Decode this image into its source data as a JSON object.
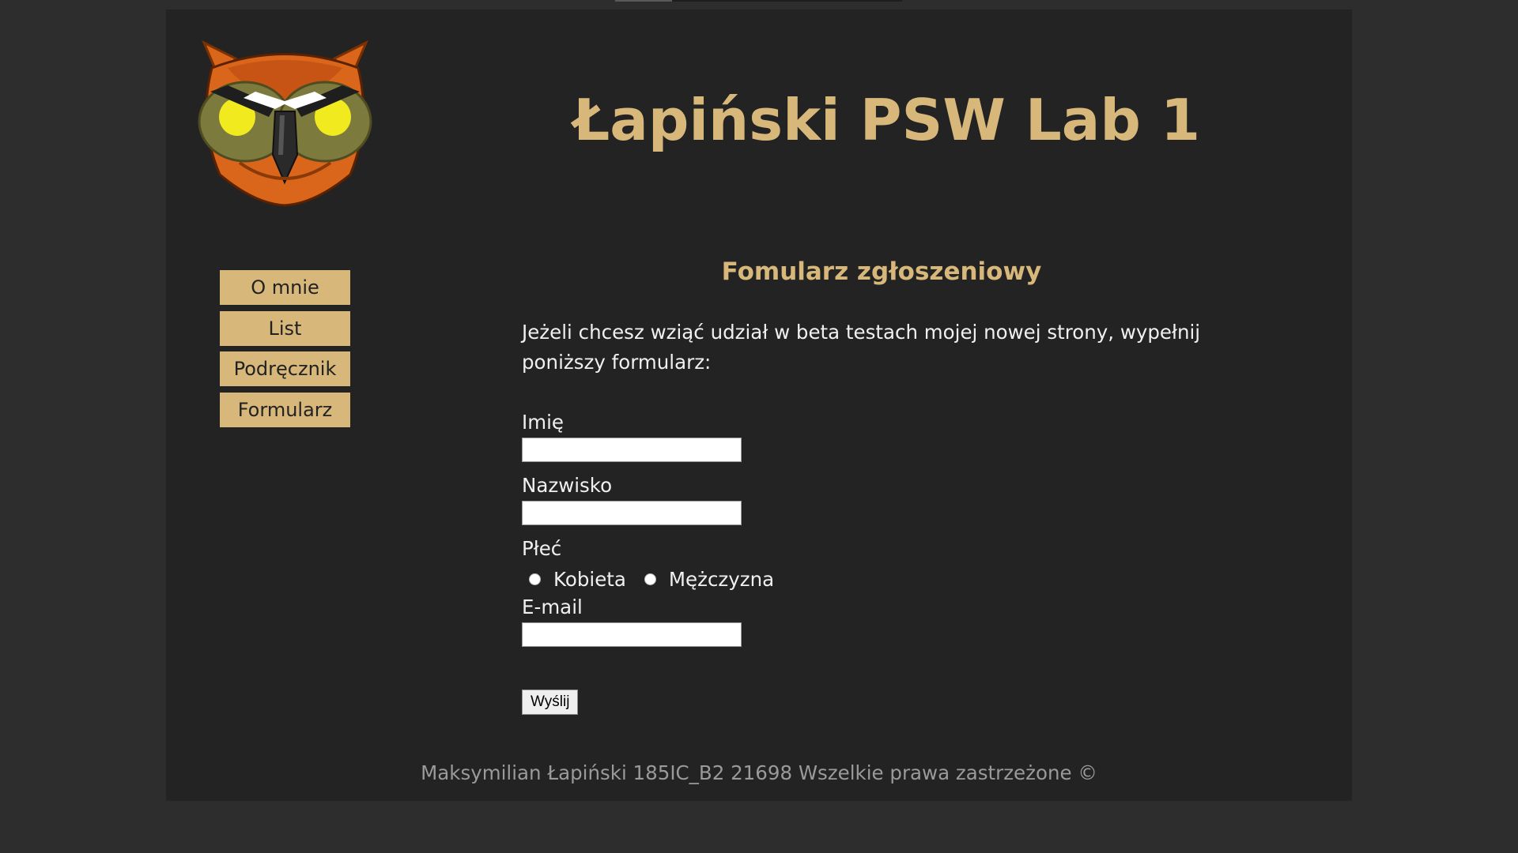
{
  "header": {
    "title": "Łapiński PSW Lab 1"
  },
  "logo": {
    "icon": "owl-logo-icon"
  },
  "nav": {
    "items": [
      {
        "label": "O mnie"
      },
      {
        "label": "List"
      },
      {
        "label": "Podręcznik"
      },
      {
        "label": "Formularz"
      }
    ]
  },
  "form": {
    "title": "Fomularz zgłoszeniowy",
    "intro": "Jeżeli chcesz wziąć udział w beta testach mojej nowej strony, wypełnij poniższy formularz:",
    "first_name": {
      "label": "Imię",
      "value": ""
    },
    "last_name": {
      "label": "Nazwisko",
      "value": ""
    },
    "gender": {
      "label": "Płeć",
      "options": [
        "Kobieta",
        "Mężczyzna"
      ]
    },
    "email": {
      "label": "E-mail",
      "value": ""
    },
    "submit_label": "Wyślij"
  },
  "footer": {
    "text": "Maksymilian Łapiński 185IC_B2 21698 Wszelkie prawa zastrzeżone ©"
  },
  "colors": {
    "accent": "#d8b87a",
    "page_bg": "#232323",
    "outer_bg": "#2d2d2d"
  }
}
